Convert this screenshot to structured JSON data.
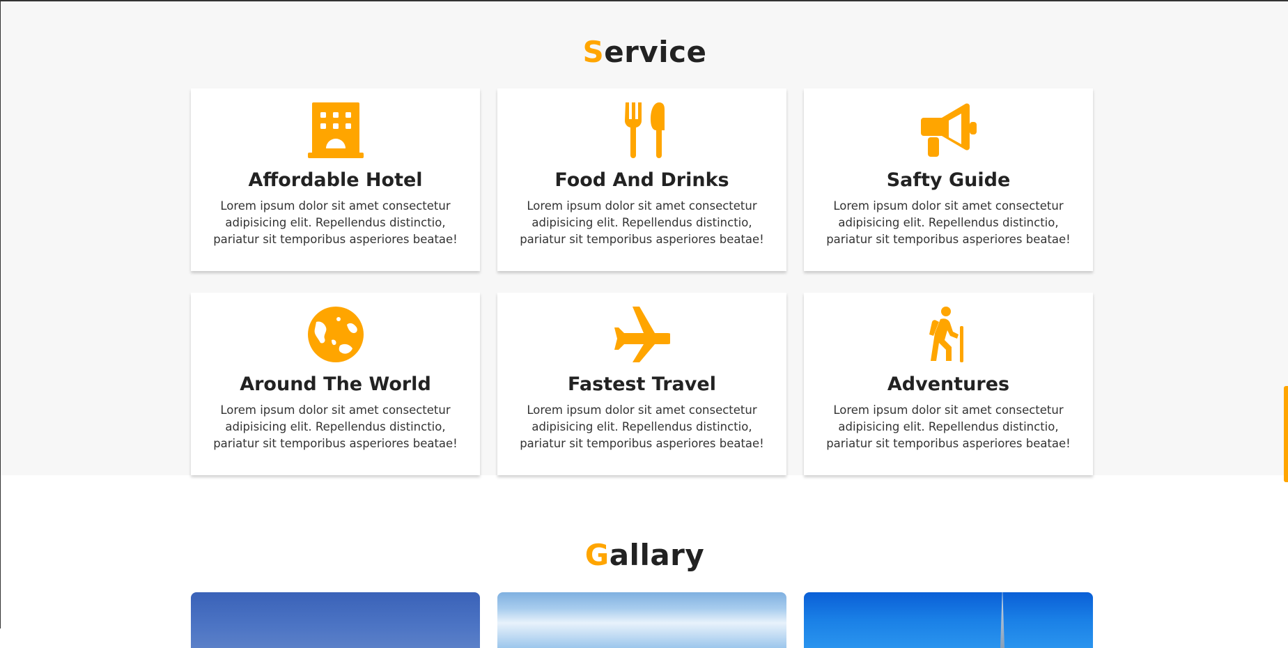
{
  "accent_color": "#ffa500",
  "service": {
    "heading_first": "S",
    "heading_rest": "ervice",
    "cards": [
      {
        "icon": "hotel-icon",
        "title": "Affordable Hotel",
        "text": "Lorem ipsum dolor sit amet consectetur adipisicing elit. Repellendus distinctio, pariatur sit temporibus asperiores beatae!"
      },
      {
        "icon": "utensils-icon",
        "title": "Food And Drinks",
        "text": "Lorem ipsum dolor sit amet consectetur adipisicing elit. Repellendus distinctio, pariatur sit temporibus asperiores beatae!"
      },
      {
        "icon": "megaphone-icon",
        "title": "Safty Guide",
        "text": "Lorem ipsum dolor sit amet consectetur adipisicing elit. Repellendus distinctio, pariatur sit temporibus asperiores beatae!"
      },
      {
        "icon": "globe-icon",
        "title": "Around The World",
        "text": "Lorem ipsum dolor sit amet consectetur adipisicing elit. Repellendus distinctio, pariatur sit temporibus asperiores beatae!"
      },
      {
        "icon": "plane-icon",
        "title": "Fastest Travel",
        "text": "Lorem ipsum dolor sit amet consectetur adipisicing elit. Repellendus distinctio, pariatur sit temporibus asperiores beatae!"
      },
      {
        "icon": "hiking-icon",
        "title": "Adventures",
        "text": "Lorem ipsum dolor sit amet consectetur adipisicing elit. Repellendus distinctio, pariatur sit temporibus asperiores beatae!"
      }
    ]
  },
  "gallery": {
    "heading_first": "G",
    "heading_rest": "allary"
  }
}
